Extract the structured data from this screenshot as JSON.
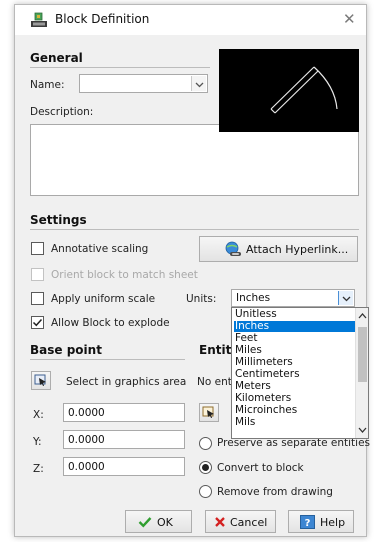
{
  "window": {
    "title": "Block Definition"
  },
  "icons": {
    "app": "block-definition-icon",
    "close": "close-icon",
    "chevron": "chevron-down-icon",
    "select": "select-in-graphics-icon",
    "hyperlink": "hyperlink-globe-icon",
    "ok": "checkmark-icon",
    "cancel": "cancel-x-icon",
    "help": "help-icon"
  },
  "general": {
    "heading": "General",
    "name_label": "Name:",
    "name_value": "",
    "description_label": "Description:",
    "description_value": ""
  },
  "settings": {
    "heading": "Settings",
    "annotative_label": "Annotative scaling",
    "annotative_checked": false,
    "orient_label": "Orient block to match sheet",
    "orient_checked": false,
    "orient_enabled": false,
    "uniform_label": "Apply uniform scale",
    "uniform_checked": false,
    "explode_label": "Allow Block to explode",
    "explode_checked": true,
    "hyperlink_button": "Attach Hyperlink...",
    "units_label": "Units:",
    "units_value": "Inches",
    "units_options": [
      "Unitless",
      "Inches",
      "Feet",
      "Miles",
      "Millimeters",
      "Centimeters",
      "Meters",
      "Kilometers",
      "Microinches",
      "Mils"
    ],
    "units_highlighted": "Inches"
  },
  "base_point": {
    "heading": "Base point",
    "select_label": "Select in graphics area",
    "x_label": "X:",
    "x_value": "0.0000",
    "y_label": "Y:",
    "y_value": "0.0000",
    "z_label": "Z:",
    "z_value": "0.0000"
  },
  "entities": {
    "heading_visible": "Entiti",
    "none_text": "No enti",
    "preserve_label": "Preserve as separate entities",
    "convert_label": "Convert to block",
    "remove_label": "Remove from drawing",
    "selected": "Convert to block"
  },
  "buttons": {
    "ok": "OK",
    "cancel": "Cancel",
    "help": "Help"
  },
  "colors": {
    "accent": "#0078d7",
    "dialog_bg": "#f0f0f0",
    "ok_check": "#2f9e2f",
    "cancel_x": "#d42020"
  }
}
